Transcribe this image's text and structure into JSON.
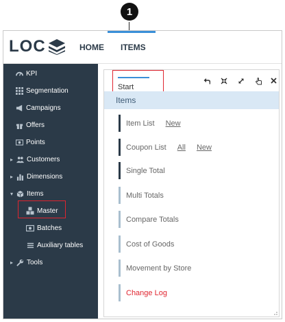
{
  "callout": {
    "number": "1"
  },
  "header": {
    "logo_text": "LOC",
    "nav": [
      {
        "label": "HOME",
        "active": false
      },
      {
        "label": "ITEMS",
        "active": true
      }
    ],
    "accent_color": "#3a8fd8"
  },
  "sidebar": {
    "bg_color": "#2b3a48",
    "items": [
      {
        "label": "KPI",
        "icon": "gauge-icon"
      },
      {
        "label": "Segmentation",
        "icon": "grid-icon"
      },
      {
        "label": "Campaigns",
        "icon": "megaphone-icon"
      },
      {
        "label": "Offers",
        "icon": "gift-icon"
      },
      {
        "label": "Points",
        "icon": "points-icon"
      },
      {
        "label": "Customers",
        "icon": "users-icon",
        "expandable": true
      },
      {
        "label": "Dimensions",
        "icon": "bar-chart-icon",
        "expandable": true
      },
      {
        "label": "Items",
        "icon": "box-icon",
        "expanded": true
      },
      {
        "label": "Master",
        "icon": "cubes-icon",
        "sub": true,
        "highlighted": true
      },
      {
        "label": "Batches",
        "icon": "batch-icon",
        "sub": true
      },
      {
        "label": "Auxiliary tables",
        "icon": "list-icon",
        "sub": true
      },
      {
        "label": "Tools",
        "icon": "wrench-icon",
        "expandable": true
      }
    ]
  },
  "panel": {
    "tab": {
      "label": "Start"
    },
    "tools": [
      "undo-icon",
      "compress-icon",
      "expand-icon",
      "pointer-icon",
      "close-icon"
    ],
    "section_title": "Items",
    "rows": [
      {
        "label": "Item List",
        "links": [
          "New"
        ]
      },
      {
        "label": "Coupon List",
        "links": [
          "All",
          "New"
        ]
      },
      {
        "label": "Single Total",
        "links": []
      },
      {
        "label": "Multi Totals",
        "links": []
      },
      {
        "label": "Compare Totals",
        "links": []
      },
      {
        "label": "Cost of Goods",
        "links": []
      },
      {
        "label": "Movement by Store",
        "links": []
      },
      {
        "label": "Change Log",
        "links": [],
        "color": "#e0252f"
      }
    ]
  }
}
